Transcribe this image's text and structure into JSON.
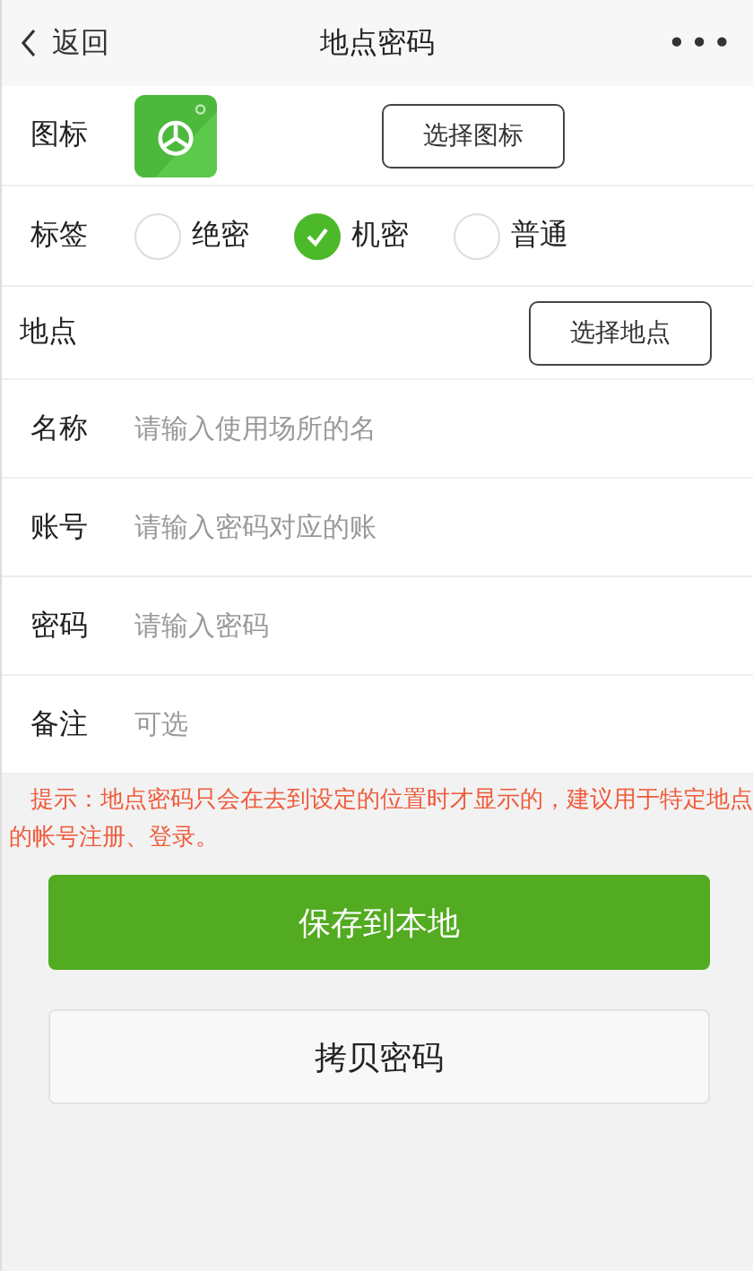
{
  "nav": {
    "back": "返回",
    "title": "地点密码",
    "more": "•••"
  },
  "icon_row": {
    "label": "图标",
    "button": "选择图标"
  },
  "tag_row": {
    "label": "标签",
    "options": [
      {
        "label": "绝密",
        "selected": false
      },
      {
        "label": "机密",
        "selected": true
      },
      {
        "label": "普通",
        "selected": false
      }
    ]
  },
  "location_row": {
    "label": "地点",
    "button": "选择地点"
  },
  "fields": [
    {
      "label": "名称",
      "placeholder": "请输入使用场所的名"
    },
    {
      "label": "账号",
      "placeholder": "请输入密码对应的账"
    },
    {
      "label": "密码",
      "placeholder": "请输入密码"
    },
    {
      "label": "备注",
      "placeholder": "可选"
    }
  ],
  "tip": "提示：地点密码只会在去到设定的位置时才显示的，建议用于特定地点的帐号注册、登录。",
  "buttons": [
    {
      "label": "保存到本地",
      "kind": "primary"
    },
    {
      "label": "拷贝密码",
      "kind": "default"
    }
  ]
}
